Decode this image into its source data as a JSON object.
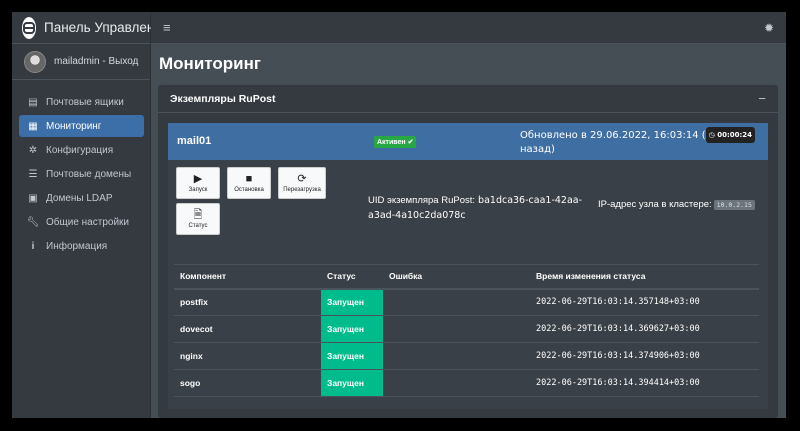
{
  "app": {
    "title": "Панель Управления"
  },
  "user": {
    "name": "mailadmin - Выход"
  },
  "sidebar": {
    "items": [
      {
        "label": "Почтовые ящики",
        "icon": "mailbox-icon"
      },
      {
        "label": "Мониторинг",
        "icon": "monitor-icon",
        "active": true
      },
      {
        "label": "Конфигурация",
        "icon": "gear-icon"
      },
      {
        "label": "Почтовые домены",
        "icon": "list-icon"
      },
      {
        "label": "Домены LDAP",
        "icon": "address-book-icon"
      },
      {
        "label": "Общие настройки",
        "icon": "wrench-icon"
      },
      {
        "label": "Информация",
        "icon": "info-icon"
      }
    ]
  },
  "page": {
    "title": "Мониторинг"
  },
  "card": {
    "title": "Экземпляры RuPost"
  },
  "instance": {
    "name": "mail01",
    "status_badge": "Активен",
    "updated_text": "Обновлено в 29.06.2022, 16:03:14 (",
    "timer": "00:00:24",
    "updated_suffix": "назад)",
    "buttons": {
      "start": "Запуск",
      "stop": "Остановка",
      "restart": "Перезагрузка",
      "status": "Статус"
    },
    "uid_label": "UID экземпляра RuPost:",
    "uid_value": "ba1dca36-caa1-42aa-a3ad-4a10c2da078c",
    "ip_label": "IP-адрес узла в кластере:",
    "ip_value": "10.0.2.15"
  },
  "table": {
    "headers": [
      "Компонент",
      "Статус",
      "Ошибка",
      "Время изменения статуса"
    ],
    "rows": [
      {
        "component": "postfix",
        "status": "Запущен",
        "error": "",
        "time": "2022-06-29T16:03:14.357148+03:00"
      },
      {
        "component": "dovecot",
        "status": "Запущен",
        "error": "",
        "time": "2022-06-29T16:03:14.369627+03:00"
      },
      {
        "component": "nginx",
        "status": "Запущен",
        "error": "",
        "time": "2022-06-29T16:03:14.374906+03:00"
      },
      {
        "component": "sogo",
        "status": "Запущен",
        "error": "",
        "time": "2022-06-29T16:03:14.394414+03:00"
      }
    ]
  },
  "colors": {
    "accent": "#3f6ea3",
    "success": "#00bc8c",
    "badge": "#28a745"
  }
}
